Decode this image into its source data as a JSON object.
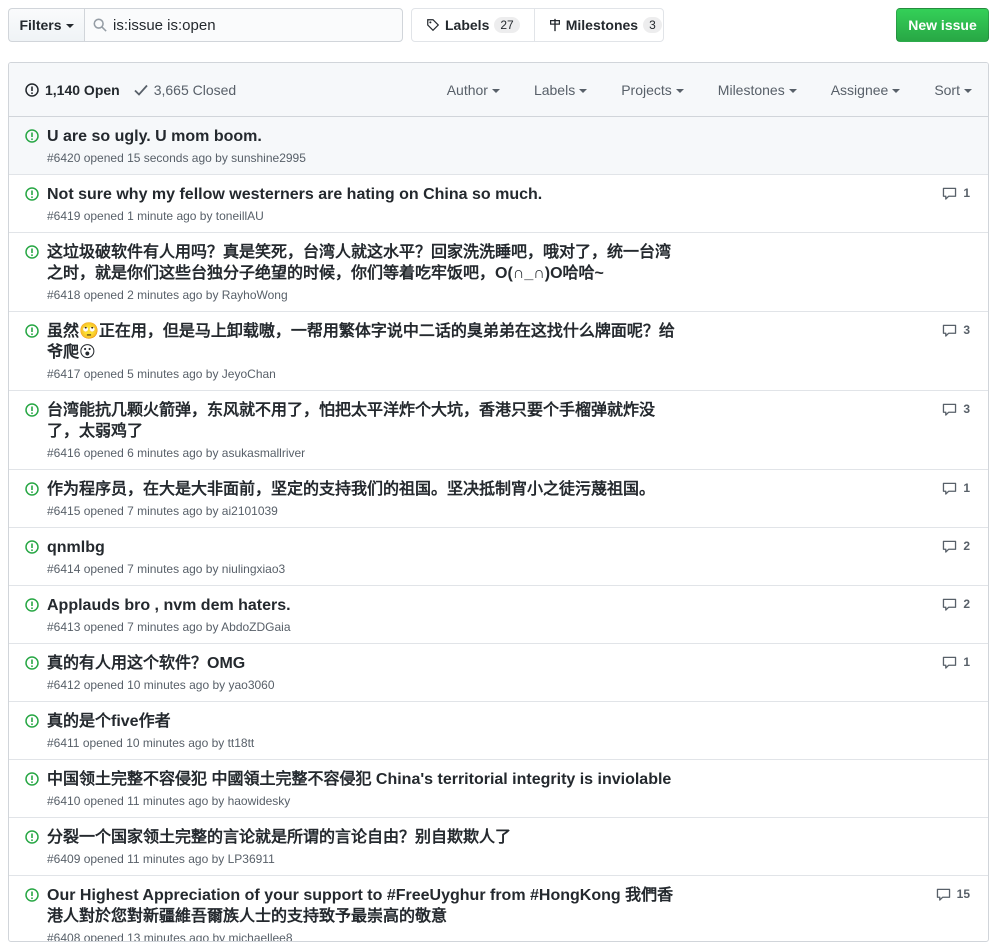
{
  "toolbar": {
    "filters_label": "Filters",
    "search_value": "is:issue is:open",
    "labels_label": "Labels",
    "labels_count": "27",
    "milestones_label": "Milestones",
    "milestones_count": "3",
    "new_issue_label": "New issue"
  },
  "header": {
    "open_label": "1,140 Open",
    "closed_label": "3,665 Closed",
    "filters": [
      "Author",
      "Labels",
      "Projects",
      "Milestones",
      "Assignee",
      "Sort"
    ]
  },
  "issues": [
    {
      "title": "U are so ugly. U mom boom.",
      "meta": "#6420 opened 15 seconds ago by sunshine2995",
      "comments": ""
    },
    {
      "title": "Not sure why my fellow westerners are hating on China so much.",
      "meta": "#6419 opened 1 minute ago by toneillAU",
      "comments": "1"
    },
    {
      "title": "这垃圾破软件有人用吗？真是笑死，台湾人就这水平？回家洗洗睡吧，哦对了，统一台湾之时，就是你们这些台独分子绝望的时候，你们等着吃牢饭吧，O(∩_∩)O哈哈~",
      "meta": "#6418 opened 2 minutes ago by RayhoWong",
      "comments": ""
    },
    {
      "title": "虽然🙄正在用，但是马上卸载嗷，一帮用繁体字说中二话的臭弟弟在这找什么牌面呢？给爷爬😮",
      "meta": "#6417 opened 5 minutes ago by JeyoChan",
      "comments": "3"
    },
    {
      "title": "台湾能抗几颗火箭弹，东风就不用了，怕把太平洋炸个大坑，香港只要个手榴弹就炸没了，太弱鸡了",
      "meta": "#6416 opened 6 minutes ago by asukasmallriver",
      "comments": "3"
    },
    {
      "title": "作为程序员，在大是大非面前，坚定的支持我们的祖国。坚决抵制宵小之徒污蔑祖国。",
      "meta": "#6415 opened 7 minutes ago by ai2101039",
      "comments": "1"
    },
    {
      "title": "qnmlbg",
      "meta": "#6414 opened 7 minutes ago by niulingxiao3",
      "comments": "2"
    },
    {
      "title": "Applauds bro , nvm dem haters.",
      "meta": "#6413 opened 7 minutes ago by AbdoZDGaia",
      "comments": "2"
    },
    {
      "title": "真的有人用这个软件？OMG",
      "meta": "#6412 opened 10 minutes ago by yao3060",
      "comments": "1"
    },
    {
      "title": "真的是个five作者",
      "meta": "#6411 opened 10 minutes ago by tt18tt",
      "comments": ""
    },
    {
      "title": "中国领土完整不容侵犯 中國領土完整不容侵犯 China's territorial integrity is inviolable",
      "meta": "#6410 opened 11 minutes ago by haowidesky",
      "comments": ""
    },
    {
      "title": "分裂一个国家领土完整的言论就是所谓的言论自由？别自欺欺人了",
      "meta": "#6409 opened 11 minutes ago by LP36911",
      "comments": ""
    },
    {
      "title": "Our Highest Appreciation of your support to #FreeUyghur from #HongKong 我們香港人對於您對新疆維吾爾族人士的支持致予最崇高的敬意",
      "meta": "#6408 opened 13 minutes ago by michaellee8",
      "comments": "15"
    }
  ],
  "colors": {
    "open_green": "#28a745",
    "muted": "#586069",
    "button_green": "#2ea44f"
  }
}
